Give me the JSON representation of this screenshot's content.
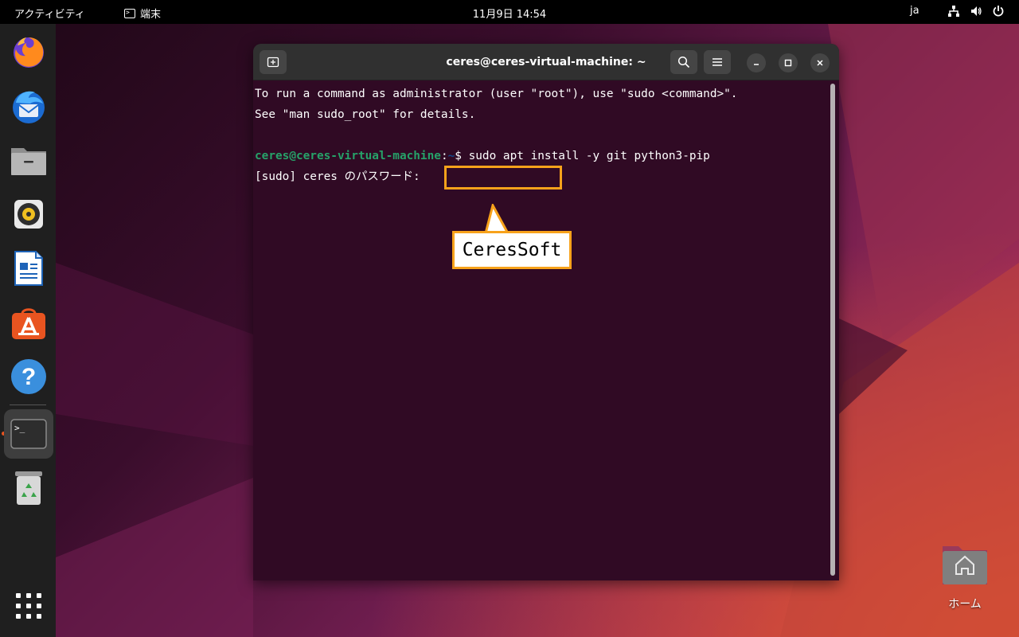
{
  "topbar": {
    "activities": "アクティビティ",
    "app_name": "端末",
    "clock": "11月9日  14:54",
    "lang": "ja"
  },
  "dock": {
    "items": [
      {
        "name": "firefox-icon"
      },
      {
        "name": "thunderbird-icon"
      },
      {
        "name": "files-icon"
      },
      {
        "name": "rhythmbox-icon"
      },
      {
        "name": "writer-icon"
      },
      {
        "name": "software-icon"
      },
      {
        "name": "help-icon"
      },
      {
        "name": "terminal-icon"
      },
      {
        "name": "trash-icon"
      },
      {
        "name": "app-grid-icon"
      }
    ],
    "active_item": "terminal-icon",
    "terminal_glyph": ">_"
  },
  "window": {
    "title": "ceres@ceres-virtual-machine: ~"
  },
  "terminal": {
    "line1": "To run a command as administrator (user \"root\"), use \"sudo <command>\".",
    "line2": "See \"man sudo_root\" for details.",
    "prompt_user": "ceres@ceres-virtual-machine",
    "prompt_sep": ":",
    "prompt_path": "~",
    "prompt_symbol": "$ ",
    "command": "sudo apt install -y git python3-pip",
    "password_prompt": "[sudo] ceres のパスワード: "
  },
  "annotation": {
    "callout_text": "CeresSoft"
  },
  "desktop": {
    "home_label": "ホーム"
  },
  "colors": {
    "terminal_bg": "#300a24",
    "prompt_green": "#26a269",
    "prompt_blue": "#12488b",
    "accent_orange": "#f7a21b",
    "ubuntu_orange": "#e95420"
  }
}
